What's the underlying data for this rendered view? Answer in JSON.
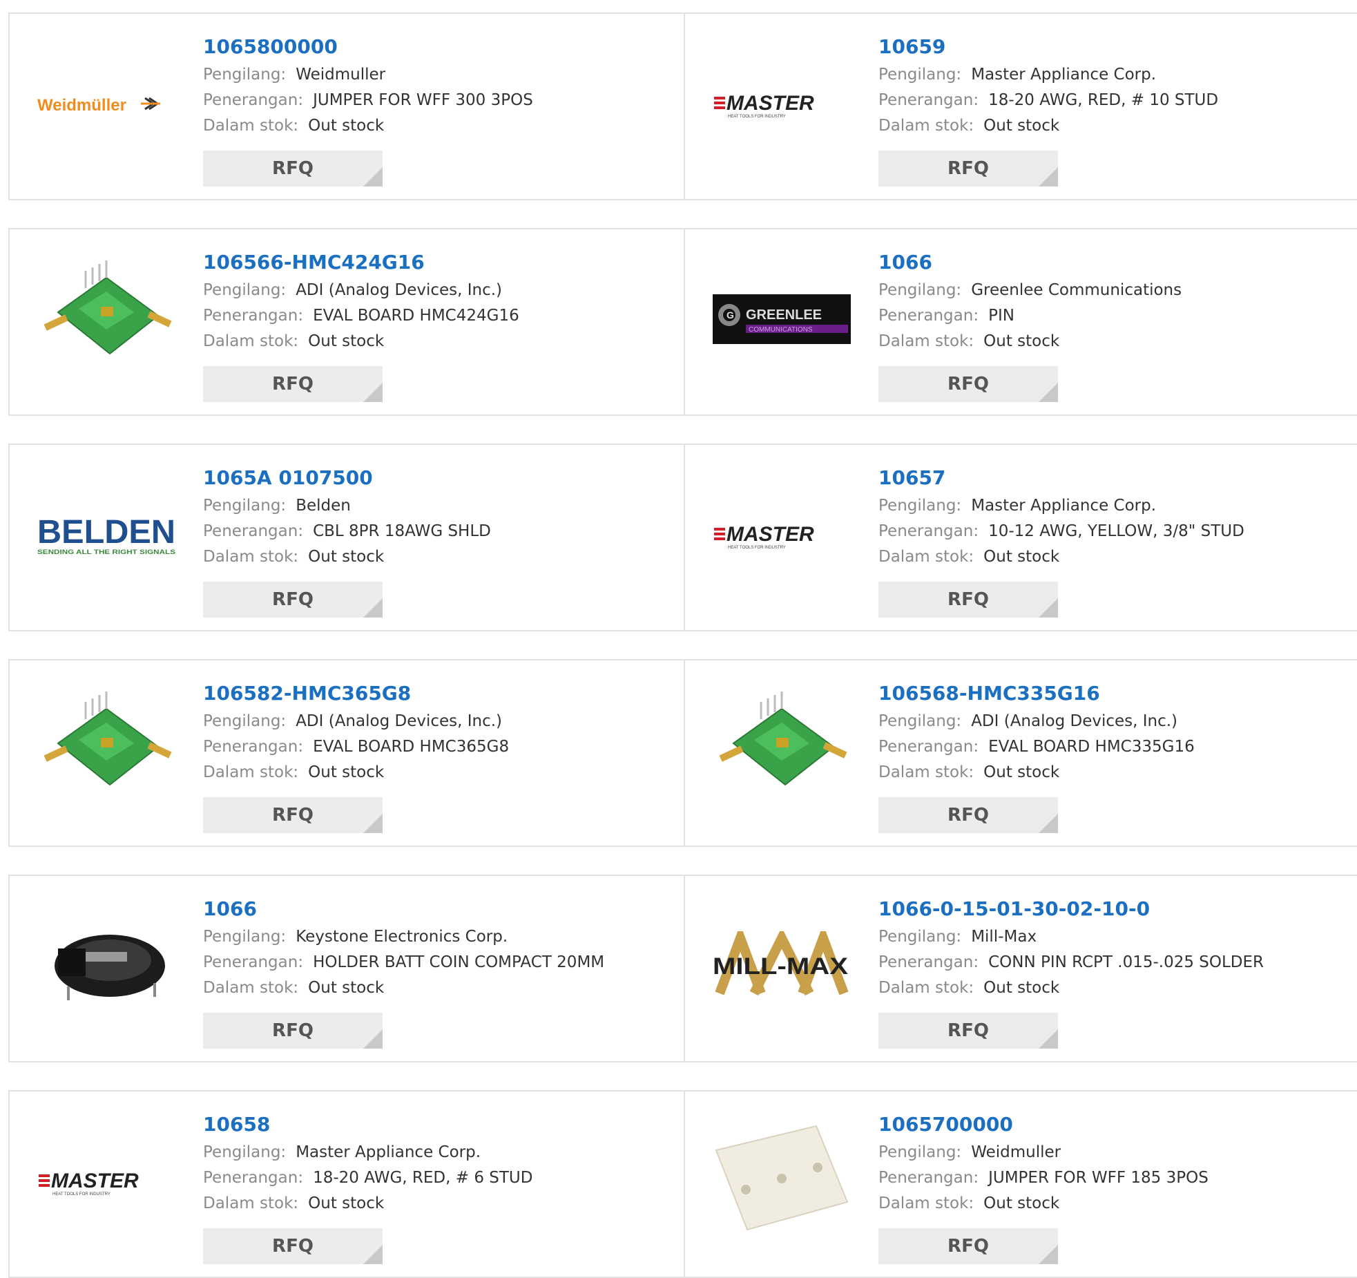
{
  "labels": {
    "manufacturer": "Pengilang:",
    "description": "Penerangan:",
    "stock": "Dalam stok:",
    "rfq": "RFQ"
  },
  "colors": {
    "link": "#1a6fc0",
    "label": "#8a8a8a",
    "button_bg": "#ececec",
    "border": "#e2e2e2"
  },
  "products": [
    {
      "part": "1065800000",
      "manufacturer": "Weidmuller",
      "description": "JUMPER FOR WFF 300 3POS",
      "stock": "Out stock",
      "image": "weidmuller-logo"
    },
    {
      "part": "10659",
      "manufacturer": "Master Appliance Corp.",
      "description": "18-20 AWG, RED, # 10 STUD",
      "stock": "Out stock",
      "image": "master-logo"
    },
    {
      "part": "106566-HMC424G16",
      "manufacturer": "ADI (Analog Devices, Inc.)",
      "description": "EVAL BOARD HMC424G16",
      "stock": "Out stock",
      "image": "eval-board-photo"
    },
    {
      "part": "1066",
      "manufacturer": "Greenlee Communications",
      "description": "PIN",
      "stock": "Out stock",
      "image": "greenlee-logo"
    },
    {
      "part": "1065A 0107500",
      "manufacturer": "Belden",
      "description": "CBL 8PR 18AWG SHLD",
      "stock": "Out stock",
      "image": "belden-logo"
    },
    {
      "part": "10657",
      "manufacturer": "Master Appliance Corp.",
      "description": "10-12 AWG, YELLOW, 3/8\" STUD",
      "stock": "Out stock",
      "image": "master-logo"
    },
    {
      "part": "106582-HMC365G8",
      "manufacturer": "ADI (Analog Devices, Inc.)",
      "description": "EVAL BOARD HMC365G8",
      "stock": "Out stock",
      "image": "eval-board-photo"
    },
    {
      "part": "106568-HMC335G16",
      "manufacturer": "ADI (Analog Devices, Inc.)",
      "description": "EVAL BOARD HMC335G16",
      "stock": "Out stock",
      "image": "eval-board-photo"
    },
    {
      "part": "1066",
      "manufacturer": "Keystone Electronics Corp.",
      "description": "HOLDER BATT COIN COMPACT 20MM",
      "stock": "Out stock",
      "image": "battery-holder-photo"
    },
    {
      "part": "1066-0-15-01-30-02-10-0",
      "manufacturer": "Mill-Max",
      "description": "CONN PIN RCPT .015-.025 SOLDER",
      "stock": "Out stock",
      "image": "millmax-logo"
    },
    {
      "part": "10658",
      "manufacturer": "Master Appliance Corp.",
      "description": "18-20 AWG, RED, # 6 STUD",
      "stock": "Out stock",
      "image": "master-logo"
    },
    {
      "part": "1065700000",
      "manufacturer": "Weidmuller",
      "description": "JUMPER FOR WFF 185 3POS",
      "stock": "Out stock",
      "image": "jumper-bar-photo"
    }
  ]
}
